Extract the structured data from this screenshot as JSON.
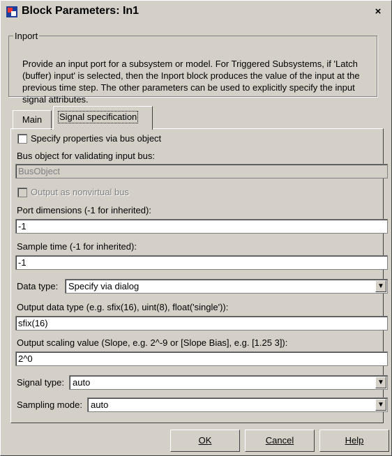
{
  "window": {
    "title": "Block Parameters: In1",
    "close_glyph": "×"
  },
  "group": {
    "legend": "Inport",
    "description": "Provide an input port for a subsystem or model. For Triggered Subsystems, if 'Latch (buffer) input' is selected, then the Inport block produces the value of the input at the previous time step. The other parameters can be used to explicitly specify the input signal attributes."
  },
  "tabs": [
    {
      "label": "Main"
    },
    {
      "label": "Signal specification"
    }
  ],
  "form": {
    "specify_bus_label": "Specify properties via bus object",
    "bus_object_label": "Bus object for validating input bus:",
    "bus_object_value": "BusObject",
    "nonvirtual_label": "Output as nonvirtual bus",
    "port_dim_label": "Port dimensions (-1 for inherited):",
    "port_dim_value": "-1",
    "sample_time_label": "Sample time (-1 for inherited):",
    "sample_time_value": "-1",
    "data_type_label": "Data type:",
    "data_type_value": "Specify via dialog",
    "out_dtype_label": "Output data type (e.g. sfix(16), uint(8), float('single')):",
    "out_dtype_value": "sfix(16)",
    "scaling_label": "Output scaling value (Slope, e.g. 2^-9 or [Slope Bias], e.g. [1.25 3]):",
    "scaling_value": "2^0",
    "signal_type_label": "Signal type:",
    "signal_type_value": "auto",
    "sampling_mode_label": "Sampling mode:",
    "sampling_mode_value": "auto"
  },
  "buttons": {
    "ok": "OK",
    "cancel": "Cancel",
    "help": "Help"
  }
}
